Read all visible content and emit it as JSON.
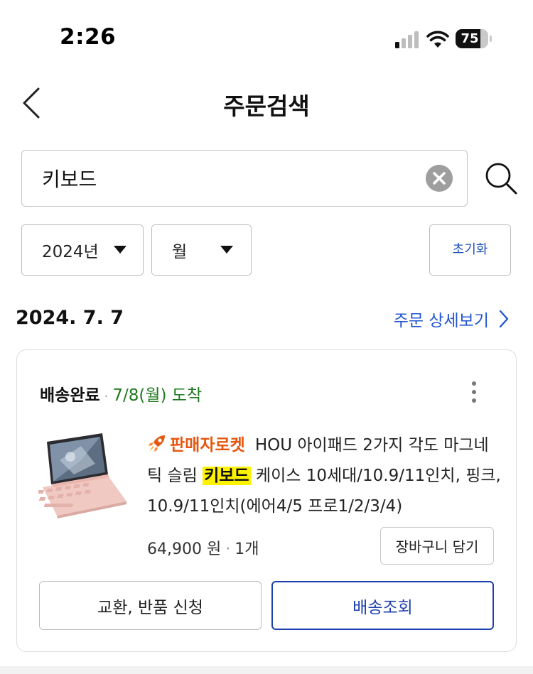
{
  "status_bar": {
    "time": "2:26",
    "battery": "75",
    "battery_level": 0.75
  },
  "header": {
    "title": "주문검색",
    "back_icon": "chevron-left-icon"
  },
  "search": {
    "value": "키보드",
    "placeholder": "",
    "clear_icon": "clear-icon",
    "search_icon": "search-icon"
  },
  "filters": {
    "year": "2024년",
    "month": "월",
    "reset_label": "초기화"
  },
  "order": {
    "date": "2024. 7. 7",
    "detail_link": "주문 상세보기",
    "status": "배송완료",
    "status_separator": "·",
    "arrival": "7/8(월) 도착",
    "product": {
      "badge": "판매자로켓",
      "name_before": "HOU 아이패드 2가지 각도 마그네틱 슬림 ",
      "name_highlight": "키보드",
      "name_after": " 케이스 10세대/10.9/11인치, 핑크, 10.9/11인치(에어4/5 프로1/2/3/4)"
    },
    "price": "64,900 원",
    "price_separator": "·",
    "quantity": "1개",
    "cart_button": "장바구니 담기",
    "exchange_button": "교환, 반품 신청",
    "tracking_button": "배송조회"
  },
  "colors": {
    "link_blue": "#2356d2",
    "tracking_blue": "#1c3fae",
    "arrival_green": "#1f7a1f",
    "rocket_orange": "#e5560f",
    "highlight_yellow": "#fff200"
  }
}
